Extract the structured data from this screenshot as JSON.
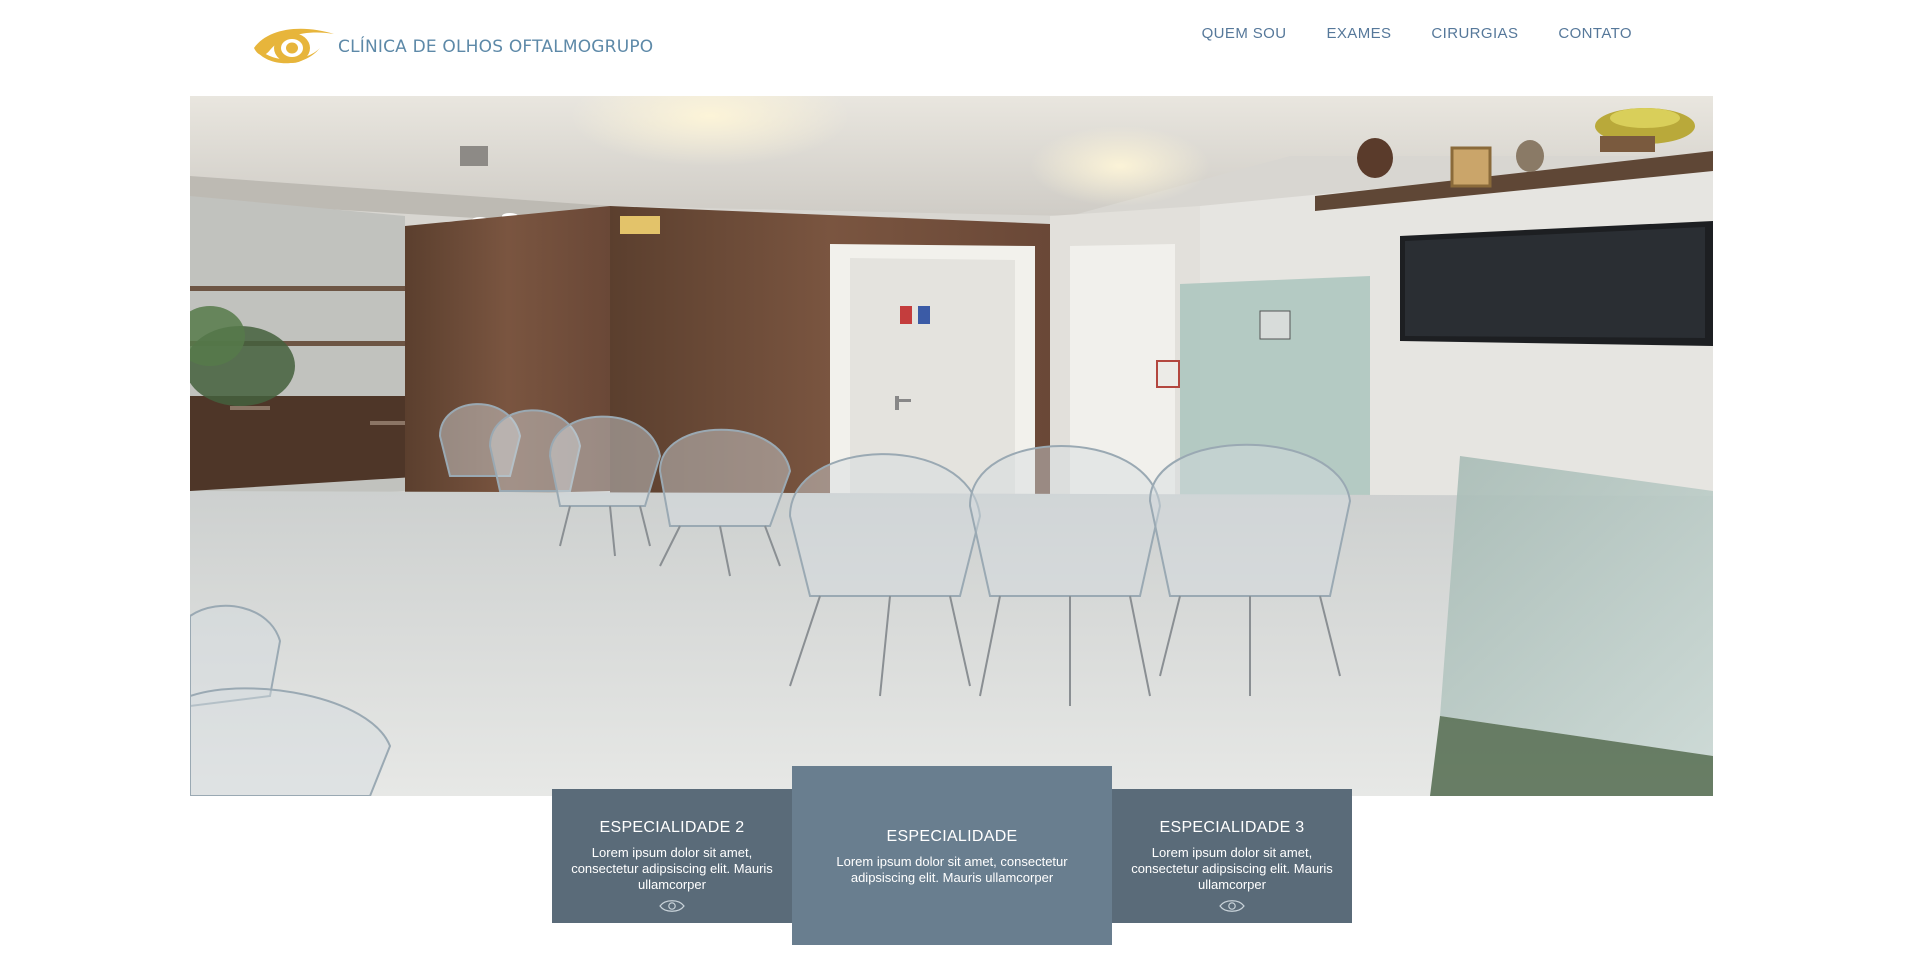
{
  "brand": {
    "name": "CLÍNICA DE OLHOS OFTALMOGRUPO",
    "logo_icon": "eye-logo",
    "logo_color": "#e7b53b",
    "text_color": "#5d89a8"
  },
  "nav": {
    "items": [
      {
        "label": "QUEM SOU"
      },
      {
        "label": "EXAMES"
      },
      {
        "label": "CIRURGIAS"
      },
      {
        "label": "CONTATO"
      }
    ]
  },
  "hero": {
    "alt": "waiting-room-photo"
  },
  "cards": {
    "left": {
      "title": "ESPECIALIDADE 2",
      "text": "Lorem ipsum dolor sit amet, consectetur adipsiscing elit. Mauris ullamcorper",
      "icon": "eye-outline-icon"
    },
    "center": {
      "title": "ESPECIALIDADE",
      "text": "Lorem ipsum dolor sit amet, consectetur adipsiscing elit. Mauris ullamcorper"
    },
    "right": {
      "title": "ESPECIALIDADE 3",
      "text": "Lorem ipsum dolor sit amet, consectetur adipsiscing elit. Mauris ullamcorper",
      "icon": "eye-outline-icon"
    }
  },
  "colors": {
    "card_side": "#5a6b79",
    "card_center": "#697e8f",
    "nav_text": "#56789a"
  }
}
